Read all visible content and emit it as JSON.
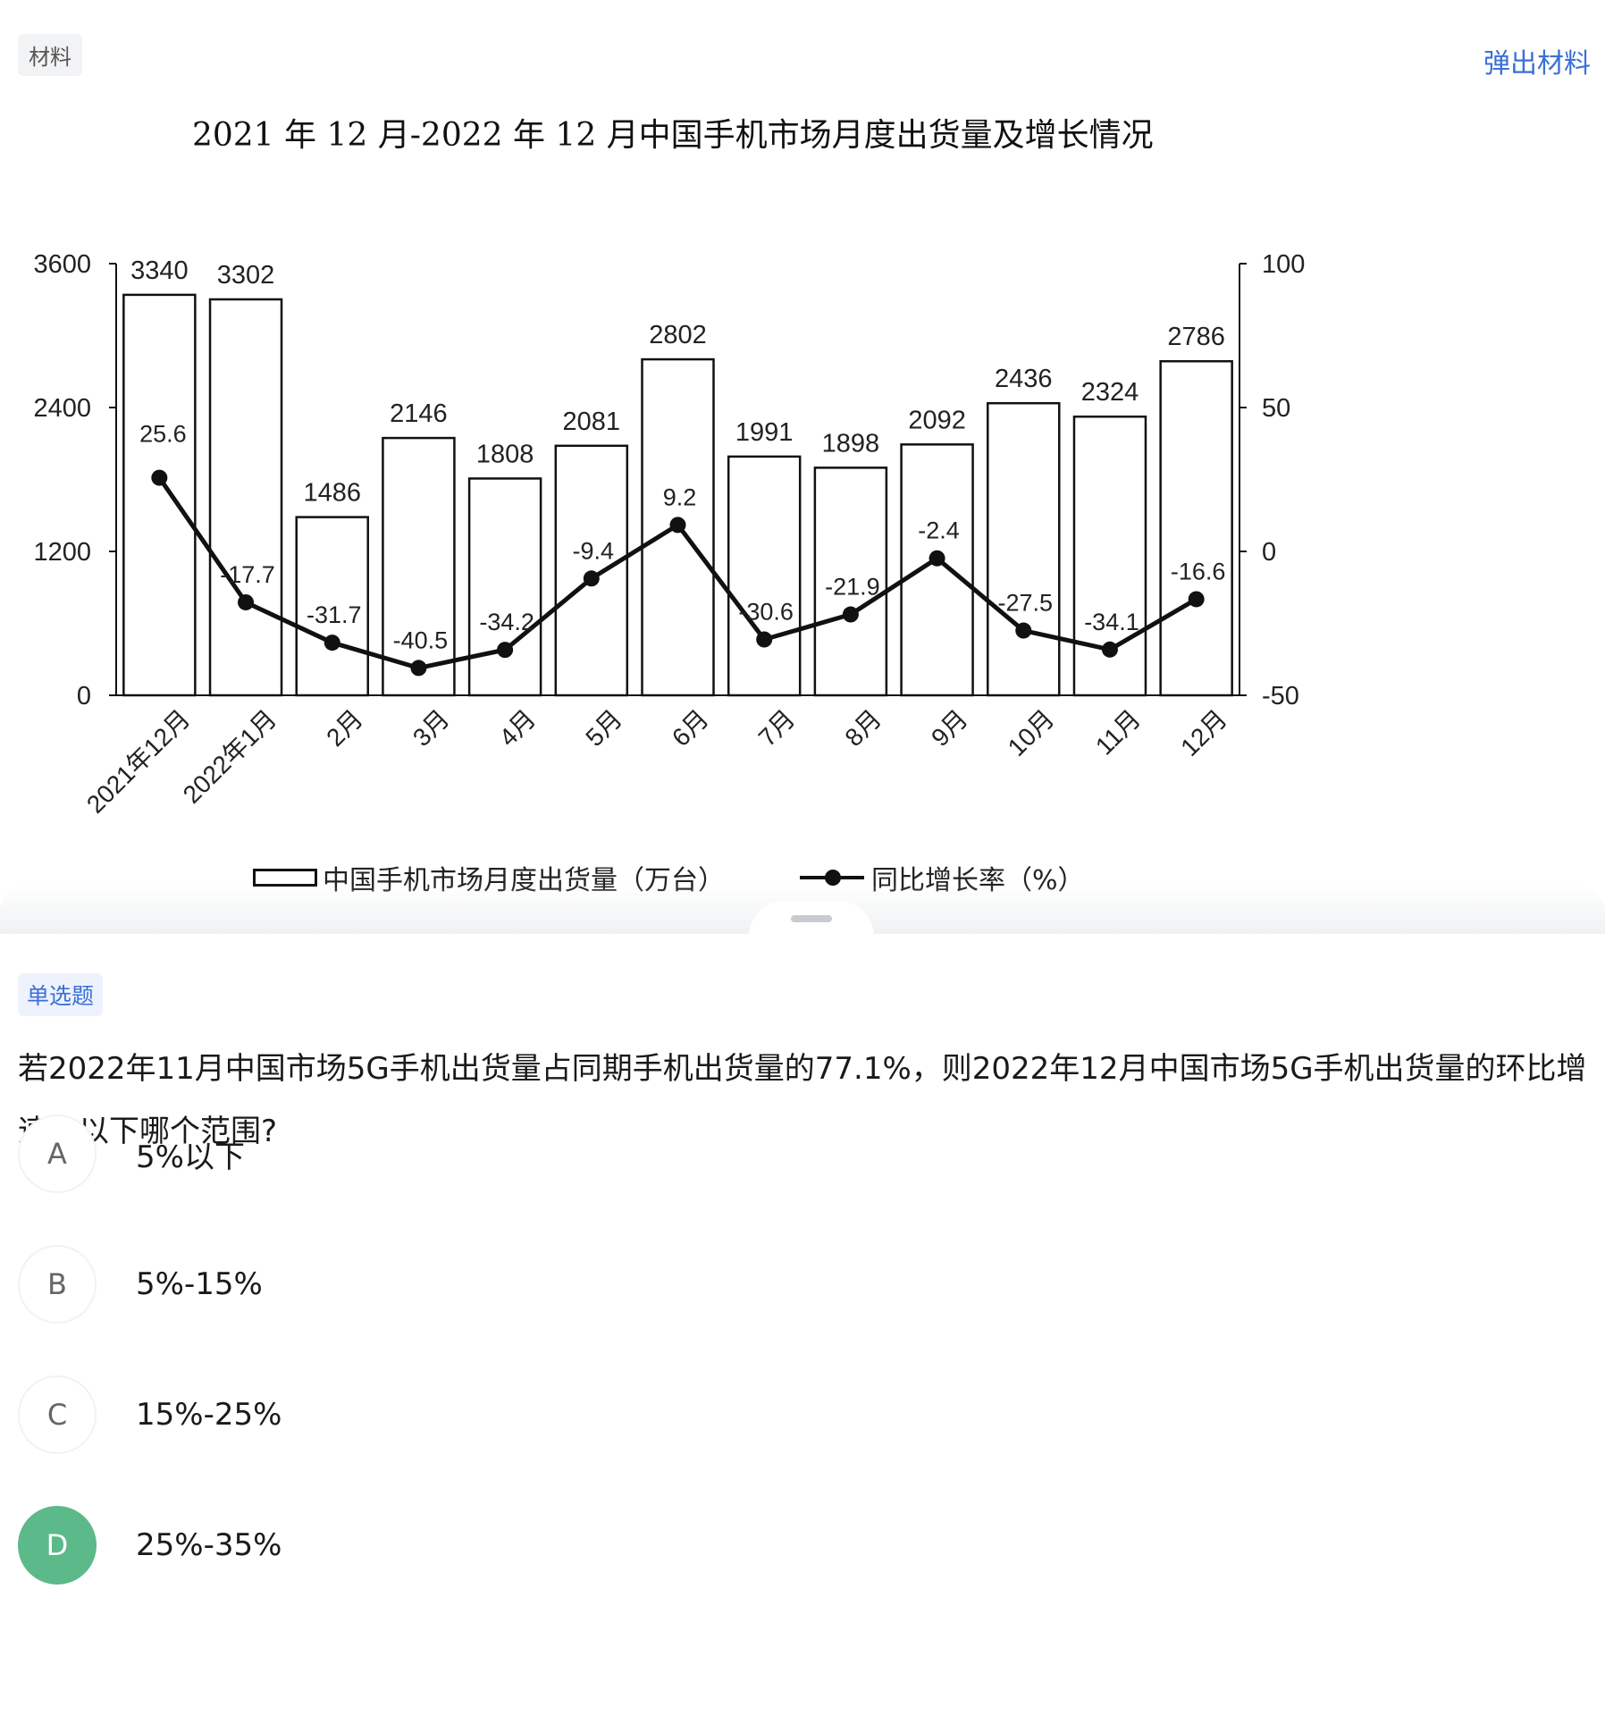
{
  "material": {
    "tag": "材料",
    "popout_label": "弹出材料"
  },
  "chart_data": {
    "type": "bar+line",
    "title": "2021 年 12 月-2022 年 12 月中国手机市场月度出货量及增长情况",
    "categories": [
      "2021年12月",
      "2022年1月",
      "2月",
      "3月",
      "4月",
      "5月",
      "6月",
      "7月",
      "8月",
      "9月",
      "10月",
      "11月",
      "12月"
    ],
    "series": [
      {
        "name": "中国手机市场月度出货量（万台）",
        "type": "bar",
        "axis": "left",
        "values": [
          3340,
          3302,
          1486,
          2146,
          1808,
          2081,
          2802,
          1991,
          1898,
          2092,
          2436,
          2324,
          2786
        ]
      },
      {
        "name": "同比增长率（%）",
        "type": "line",
        "axis": "right",
        "values": [
          25.6,
          -17.7,
          -31.7,
          -40.5,
          -34.2,
          -9.4,
          9.2,
          -30.6,
          -21.9,
          -2.4,
          -27.5,
          -34.1,
          -16.6
        ]
      }
    ],
    "y_left": {
      "ticks": [
        0,
        1200,
        2400,
        3600
      ],
      "ylim": [
        0,
        3600
      ]
    },
    "y_right": {
      "ticks": [
        -50,
        0,
        50,
        100
      ],
      "ylim": [
        -50,
        100
      ]
    },
    "legend_position": "bottom"
  },
  "question": {
    "type_label": "单选题",
    "text": "若2022年11月中国市场5G手机出货量占同期手机出货量的77.1%，则2022年12月中国市场5G手机出货量的环比增速在以下哪个范围?",
    "options": [
      {
        "letter": "A",
        "text": "5%以下"
      },
      {
        "letter": "B",
        "text": "5%-15%"
      },
      {
        "letter": "C",
        "text": "15%-25%"
      },
      {
        "letter": "D",
        "text": "25%-35%"
      }
    ],
    "selected": "D",
    "selected_color": "#5cb98a"
  }
}
